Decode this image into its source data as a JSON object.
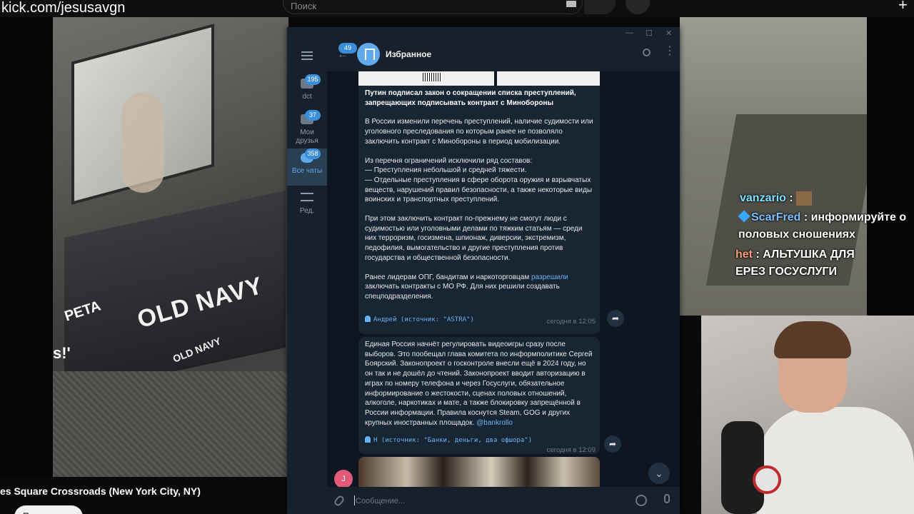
{
  "overlay": {
    "url": "kick.com/jesusavgn"
  },
  "youtube": {
    "search_placeholder": "Поиск",
    "video_title": "es Square Crossroads (New York City, NY)",
    "subscribe_label": "Подписаться"
  },
  "stream_signs": {
    "old_navy": "OLD NAVY",
    "old_navy_small": "OLD NAVY",
    "peta": "PETA",
    "left_fragment": "s!'"
  },
  "chat": {
    "lines": [
      {
        "user": "vanzario",
        "text": " :"
      },
      {
        "user": "ScarFred",
        "text": " : информируйте о"
      },
      {
        "user": "",
        "text": "половых сношениях"
      },
      {
        "user": "het",
        "text": " : АЛЬТУШКА ДЛЯ"
      },
      {
        "user": "",
        "text": "ЕРЕЗ ГОСУСЛУГИ"
      }
    ]
  },
  "telegram": {
    "window_buttons": [
      "—",
      "☐",
      "✕"
    ],
    "sidebar": {
      "folders": [
        {
          "label": "dct",
          "badge": "195"
        },
        {
          "label": "Мои друзья",
          "badge": "37"
        },
        {
          "label": "Все чаты",
          "badge": "358",
          "active": true
        },
        {
          "label": "Ред.",
          "badge": ""
        }
      ]
    },
    "header": {
      "back_badge": "49",
      "title": "Избранное"
    },
    "messages": [
      {
        "title": "Путин подписал закон о сокращении списка преступлений, запрещающих подписывать контракт с Минобороны",
        "p1": "В России изменили перечень преступлений, наличие судимости или уголовного преследования по которым ранее не позволяло заключить контракт с Минобороны в период мобилизации.",
        "p2": "Из перечня ограничений исключили ряд составов:\n— Преступления небольшой и средней тяжести.\n— Отдельные преступления в сфере оборота оружия и взрывчатых веществ, нарушений правил безопасности, а также некоторые виды воинских и транспортных преступлений.",
        "p3": "При этом заключить контракт по-прежнему не смогут люди с судимостью или уголовными делами по тяжким статьям — среди них терроризм, госизмена, шпионаж, диверсии, экстремизм, педофилия, вымогательство и другие преступления против государства и общественной безопасности.",
        "p4_before": "Ранее лидерам ОПГ, бандитам и наркоторговцам ",
        "p4_link": "разрешили",
        "p4_after": " заключать контракты с МО РФ. Для них решили создавать спецподразделения.",
        "source": "Андрей (источник: \"ASTRA\")",
        "time": "сегодня в 12:05"
      },
      {
        "text": "Единая Россия начнёт регулировать видеоигры сразу после выборов. Это пообещал глава комитета по информполитике Сергей Боярский. Законопроект о госконтроле внесли ещё в 2024 году, но он так и не дошёл до чтений. Законопроект вводит авторизацию в играх по номеру телефона и через Госуслуги, обязательное информирование о жестокости, сценах половых отношений, алкоголе, наркотиках и мате, а также блокировку запрещённой в России информации. Правила коснутся Steam, GOG и других крупных иностранных площадок. ",
        "mention": "@bankrollo",
        "source": "Н (источник: \"Банки, деньги, два офшора\")",
        "time": "сегодня в 12:09"
      }
    ],
    "avatar_letter": "J",
    "input_placeholder": "Сообщение..."
  }
}
